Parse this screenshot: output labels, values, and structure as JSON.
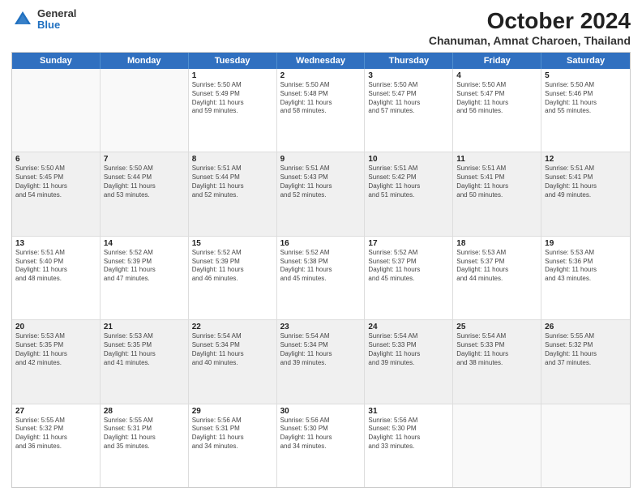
{
  "logo": {
    "general": "General",
    "blue": "Blue"
  },
  "header": {
    "title": "October 2024",
    "subtitle": "Chanuman, Amnat Charoen, Thailand"
  },
  "days": [
    "Sunday",
    "Monday",
    "Tuesday",
    "Wednesday",
    "Thursday",
    "Friday",
    "Saturday"
  ],
  "weeks": [
    [
      {
        "day": "",
        "info": ""
      },
      {
        "day": "",
        "info": ""
      },
      {
        "day": "1",
        "info": "Sunrise: 5:50 AM\nSunset: 5:49 PM\nDaylight: 11 hours\nand 59 minutes."
      },
      {
        "day": "2",
        "info": "Sunrise: 5:50 AM\nSunset: 5:48 PM\nDaylight: 11 hours\nand 58 minutes."
      },
      {
        "day": "3",
        "info": "Sunrise: 5:50 AM\nSunset: 5:47 PM\nDaylight: 11 hours\nand 57 minutes."
      },
      {
        "day": "4",
        "info": "Sunrise: 5:50 AM\nSunset: 5:47 PM\nDaylight: 11 hours\nand 56 minutes."
      },
      {
        "day": "5",
        "info": "Sunrise: 5:50 AM\nSunset: 5:46 PM\nDaylight: 11 hours\nand 55 minutes."
      }
    ],
    [
      {
        "day": "6",
        "info": "Sunrise: 5:50 AM\nSunset: 5:45 PM\nDaylight: 11 hours\nand 54 minutes."
      },
      {
        "day": "7",
        "info": "Sunrise: 5:50 AM\nSunset: 5:44 PM\nDaylight: 11 hours\nand 53 minutes."
      },
      {
        "day": "8",
        "info": "Sunrise: 5:51 AM\nSunset: 5:44 PM\nDaylight: 11 hours\nand 52 minutes."
      },
      {
        "day": "9",
        "info": "Sunrise: 5:51 AM\nSunset: 5:43 PM\nDaylight: 11 hours\nand 52 minutes."
      },
      {
        "day": "10",
        "info": "Sunrise: 5:51 AM\nSunset: 5:42 PM\nDaylight: 11 hours\nand 51 minutes."
      },
      {
        "day": "11",
        "info": "Sunrise: 5:51 AM\nSunset: 5:41 PM\nDaylight: 11 hours\nand 50 minutes."
      },
      {
        "day": "12",
        "info": "Sunrise: 5:51 AM\nSunset: 5:41 PM\nDaylight: 11 hours\nand 49 minutes."
      }
    ],
    [
      {
        "day": "13",
        "info": "Sunrise: 5:51 AM\nSunset: 5:40 PM\nDaylight: 11 hours\nand 48 minutes."
      },
      {
        "day": "14",
        "info": "Sunrise: 5:52 AM\nSunset: 5:39 PM\nDaylight: 11 hours\nand 47 minutes."
      },
      {
        "day": "15",
        "info": "Sunrise: 5:52 AM\nSunset: 5:39 PM\nDaylight: 11 hours\nand 46 minutes."
      },
      {
        "day": "16",
        "info": "Sunrise: 5:52 AM\nSunset: 5:38 PM\nDaylight: 11 hours\nand 45 minutes."
      },
      {
        "day": "17",
        "info": "Sunrise: 5:52 AM\nSunset: 5:37 PM\nDaylight: 11 hours\nand 45 minutes."
      },
      {
        "day": "18",
        "info": "Sunrise: 5:53 AM\nSunset: 5:37 PM\nDaylight: 11 hours\nand 44 minutes."
      },
      {
        "day": "19",
        "info": "Sunrise: 5:53 AM\nSunset: 5:36 PM\nDaylight: 11 hours\nand 43 minutes."
      }
    ],
    [
      {
        "day": "20",
        "info": "Sunrise: 5:53 AM\nSunset: 5:35 PM\nDaylight: 11 hours\nand 42 minutes."
      },
      {
        "day": "21",
        "info": "Sunrise: 5:53 AM\nSunset: 5:35 PM\nDaylight: 11 hours\nand 41 minutes."
      },
      {
        "day": "22",
        "info": "Sunrise: 5:54 AM\nSunset: 5:34 PM\nDaylight: 11 hours\nand 40 minutes."
      },
      {
        "day": "23",
        "info": "Sunrise: 5:54 AM\nSunset: 5:34 PM\nDaylight: 11 hours\nand 39 minutes."
      },
      {
        "day": "24",
        "info": "Sunrise: 5:54 AM\nSunset: 5:33 PM\nDaylight: 11 hours\nand 39 minutes."
      },
      {
        "day": "25",
        "info": "Sunrise: 5:54 AM\nSunset: 5:33 PM\nDaylight: 11 hours\nand 38 minutes."
      },
      {
        "day": "26",
        "info": "Sunrise: 5:55 AM\nSunset: 5:32 PM\nDaylight: 11 hours\nand 37 minutes."
      }
    ],
    [
      {
        "day": "27",
        "info": "Sunrise: 5:55 AM\nSunset: 5:32 PM\nDaylight: 11 hours\nand 36 minutes."
      },
      {
        "day": "28",
        "info": "Sunrise: 5:55 AM\nSunset: 5:31 PM\nDaylight: 11 hours\nand 35 minutes."
      },
      {
        "day": "29",
        "info": "Sunrise: 5:56 AM\nSunset: 5:31 PM\nDaylight: 11 hours\nand 34 minutes."
      },
      {
        "day": "30",
        "info": "Sunrise: 5:56 AM\nSunset: 5:30 PM\nDaylight: 11 hours\nand 34 minutes."
      },
      {
        "day": "31",
        "info": "Sunrise: 5:56 AM\nSunset: 5:30 PM\nDaylight: 11 hours\nand 33 minutes."
      },
      {
        "day": "",
        "info": ""
      },
      {
        "day": "",
        "info": ""
      }
    ]
  ]
}
